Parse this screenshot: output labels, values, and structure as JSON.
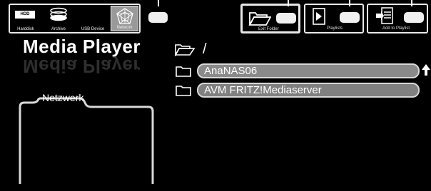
{
  "app": {
    "title": "Media Player"
  },
  "sources": [
    {
      "label": "Harddisk",
      "icon": "harddisk-icon",
      "badge": "HDD"
    },
    {
      "label": "Archive",
      "icon": "archive-icon"
    },
    {
      "label": "USB Device",
      "icon": "usb-device-icon"
    },
    {
      "label": "Network",
      "icon": "network-icon",
      "selected": true
    }
  ],
  "toolbar": {
    "exit_folder_label": "Exit Folder",
    "playlists_label": "Playlists",
    "add_to_playlist_label": "Add to Playlist"
  },
  "breadcrumb": {
    "path": "/"
  },
  "folders": [
    {
      "name": "AnaNAS06",
      "selected": true
    },
    {
      "name": "AVM FRITZ!Mediaserver",
      "selected": false
    }
  ],
  "info_panel": {
    "tab_label": "Netzwerk"
  },
  "colors": {
    "background": "#000000",
    "row_fill": "#808080",
    "row_border": "#d8d8d8",
    "text": "#ffffff"
  }
}
